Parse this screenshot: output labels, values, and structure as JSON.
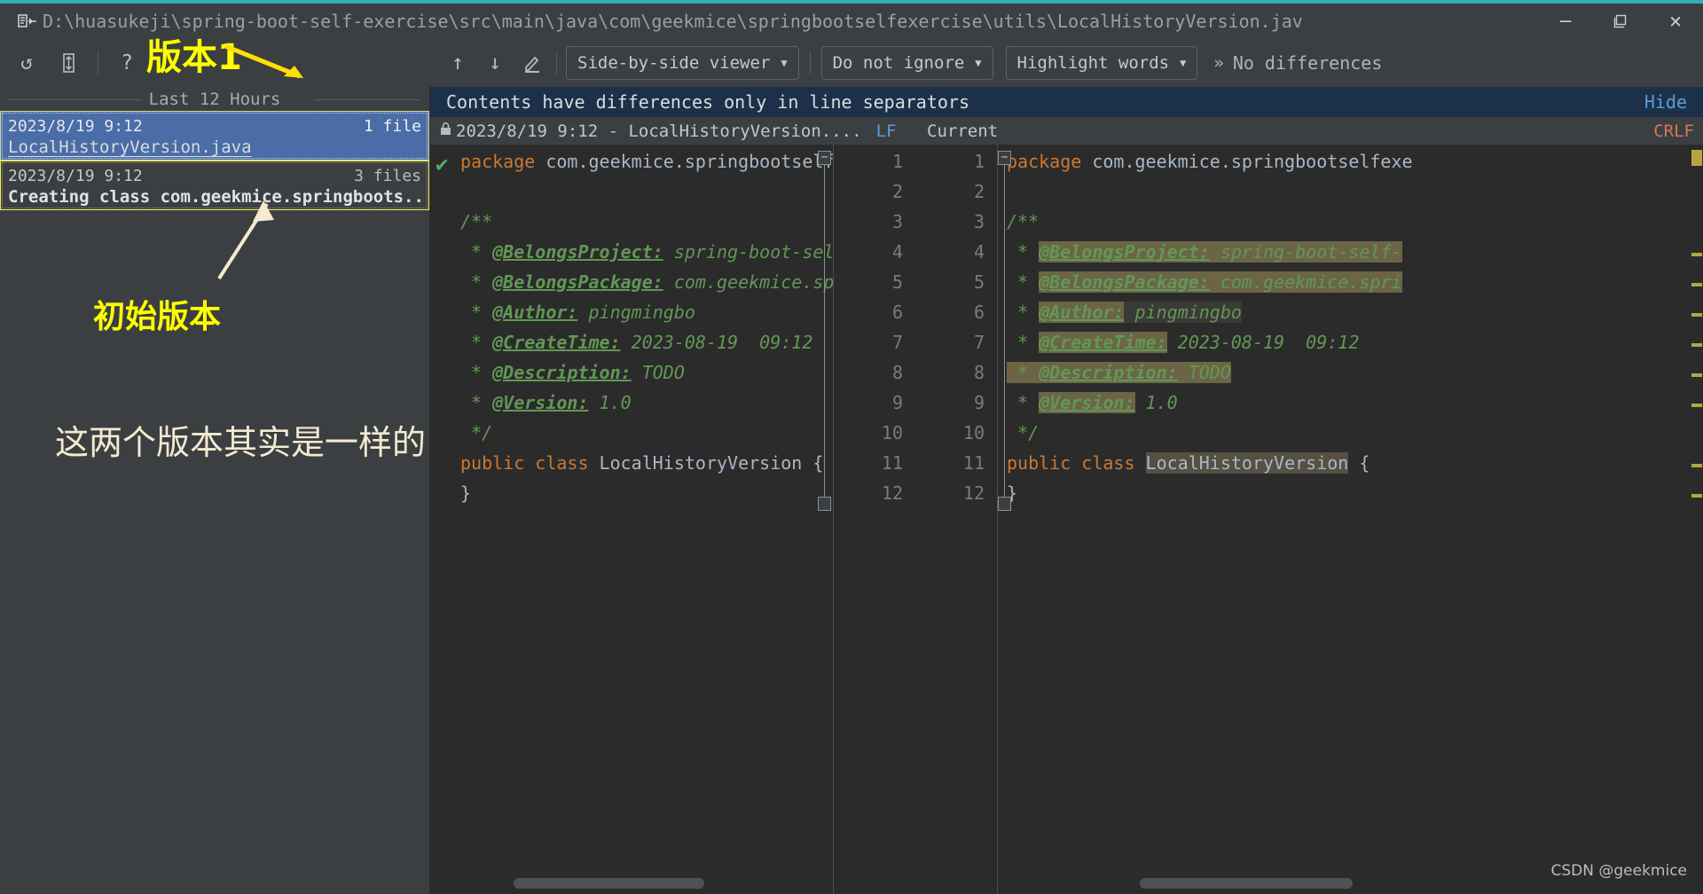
{
  "window": {
    "title": "D:\\huasukeji\\spring-boot-self-exercise\\src\\main\\java\\com\\geekmice\\springbootselfexercise\\utils\\LocalHistoryVersion.jav",
    "app_icon": "diff-window-icon",
    "minimize_label": "─",
    "maximize_label": "❐",
    "close_label": "✕"
  },
  "toolbar": {
    "undo_label": "↺",
    "revert_label": "☰",
    "help_label": "?",
    "prev_diff_label": "↑",
    "next_diff_label": "↓",
    "edit_label": "✎",
    "viewer_mode": "Side-by-side viewer",
    "ignore_mode": "Do not ignore",
    "highlight_mode": "Highlight words",
    "caret": "▼",
    "overflow_label": "»",
    "status": "No differences"
  },
  "history": {
    "group_header": "Last 12 Hours",
    "items": [
      {
        "date": "2023/8/19 9:12",
        "count": "1 file",
        "label": "LocalHistoryVersion.java",
        "selected": true
      },
      {
        "date": "2023/8/19 9:12",
        "count": "3 files",
        "label": "Creating class com.geekmice.springboots..",
        "selected": false
      }
    ]
  },
  "annotations": {
    "version1": "版本1",
    "initial_version": "初始版本",
    "same_note": "这两个版本其实是一样的"
  },
  "notification": {
    "message": "Contents have differences only in line separators",
    "hide_label": "Hide"
  },
  "diff_header": {
    "lock_icon": "🔒",
    "left_title": "2023/8/19 9:12 - LocalHistoryVersion....",
    "left_sep": "LF",
    "right_title": "Current",
    "right_sep": "CRLF"
  },
  "diff": {
    "line_numbers": [
      "1",
      "2",
      "3",
      "4",
      "5",
      "6",
      "7",
      "8",
      "9",
      "10",
      "11",
      "12"
    ],
    "left_lines": [
      {
        "n": "1",
        "parts": [
          {
            "t": "package ",
            "c": "kw"
          },
          {
            "t": "com.geekmice.springbootselfe",
            "c": "txt"
          }
        ]
      },
      {
        "n": "2",
        "parts": []
      },
      {
        "n": "3",
        "parts": [
          {
            "t": "/**",
            "c": "cmt"
          }
        ]
      },
      {
        "n": "4",
        "parts": [
          {
            "t": " * ",
            "c": "cmt"
          },
          {
            "t": "@BelongsProject:",
            "c": "tag"
          },
          {
            "t": " spring-boot-sel",
            "c": "cmt"
          }
        ]
      },
      {
        "n": "5",
        "parts": [
          {
            "t": " * ",
            "c": "cmt"
          },
          {
            "t": "@BelongsPackage:",
            "c": "tag"
          },
          {
            "t": " com.geekmice.sp",
            "c": "cmt"
          }
        ]
      },
      {
        "n": "6",
        "parts": [
          {
            "t": " * ",
            "c": "cmt"
          },
          {
            "t": "@Author:",
            "c": "tag"
          },
          {
            "t": " pingmingbo",
            "c": "cmt"
          }
        ]
      },
      {
        "n": "7",
        "parts": [
          {
            "t": " * ",
            "c": "cmt"
          },
          {
            "t": "@CreateTime:",
            "c": "tag"
          },
          {
            "t": " 2023-08-19  09:12",
            "c": "cmt"
          }
        ]
      },
      {
        "n": "8",
        "parts": [
          {
            "t": " * ",
            "c": "cmt"
          },
          {
            "t": "@Description:",
            "c": "tag"
          },
          {
            "t": " TODO",
            "c": "cmt"
          }
        ]
      },
      {
        "n": "9",
        "parts": [
          {
            "t": " * ",
            "c": "cmt"
          },
          {
            "t": "@Version:",
            "c": "tag"
          },
          {
            "t": " 1.0",
            "c": "cmt"
          }
        ]
      },
      {
        "n": "10",
        "parts": [
          {
            "t": " */",
            "c": "cmt"
          }
        ]
      },
      {
        "n": "11",
        "parts": [
          {
            "t": "public class ",
            "c": "kw"
          },
          {
            "t": "LocalHistoryVersion {",
            "c": "txt"
          }
        ]
      },
      {
        "n": "12",
        "parts": [
          {
            "t": "}",
            "c": "txt"
          }
        ]
      }
    ],
    "right_lines": [
      {
        "n": "1",
        "parts": [
          {
            "t": "package ",
            "c": "kw"
          },
          {
            "t": "com.geekmice.springbootselfexe",
            "c": "txt"
          }
        ]
      },
      {
        "n": "2",
        "parts": []
      },
      {
        "n": "3",
        "parts": [
          {
            "t": "/**",
            "c": "cmt"
          }
        ]
      },
      {
        "n": "4",
        "parts": [
          {
            "t": " * ",
            "c": "cmt"
          },
          {
            "t": "@BelongsProject:",
            "c": "tag-hl"
          },
          {
            "t": " spring-boot-self-",
            "c": "cmt-hl"
          }
        ]
      },
      {
        "n": "5",
        "parts": [
          {
            "t": " * ",
            "c": "cmt"
          },
          {
            "t": "@BelongsPackage:",
            "c": "tag-hl"
          },
          {
            "t": " com.geekmice.spri",
            "c": "cmt-hl"
          }
        ]
      },
      {
        "n": "6",
        "parts": [
          {
            "t": " * ",
            "c": "cmt"
          },
          {
            "t": "@Author:",
            "c": "tag-hl"
          },
          {
            "t": " pingmingbo",
            "c": "cmt-dark"
          }
        ]
      },
      {
        "n": "7",
        "parts": [
          {
            "t": " * ",
            "c": "cmt"
          },
          {
            "t": "@CreateTime:",
            "c": "tag-hl"
          },
          {
            "t": " 2023-08-19  09:12",
            "c": "cmt"
          }
        ]
      },
      {
        "n": "8",
        "parts": [
          {
            "t": " * ",
            "c": "cmt-hl"
          },
          {
            "t": "@Description:",
            "c": "tag-hl"
          },
          {
            "t": " TODO",
            "c": "cmt-hl"
          }
        ]
      },
      {
        "n": "9",
        "parts": [
          {
            "t": " * ",
            "c": "cmt"
          },
          {
            "t": "@Version:",
            "c": "tag-hl"
          },
          {
            "t": " 1.0",
            "c": "cmt"
          }
        ]
      },
      {
        "n": "10",
        "parts": [
          {
            "t": " */",
            "c": "cmt"
          }
        ]
      },
      {
        "n": "11",
        "parts": [
          {
            "t": "public class ",
            "c": "kw"
          },
          {
            "t": "LocalHistoryVersion",
            "c": "txt-hl"
          },
          {
            "t": " {",
            "c": "txt"
          }
        ]
      },
      {
        "n": "12",
        "parts": [
          {
            "t": "}",
            "c": "txt"
          }
        ]
      }
    ]
  },
  "watermark": "CSDN @geekmice"
}
